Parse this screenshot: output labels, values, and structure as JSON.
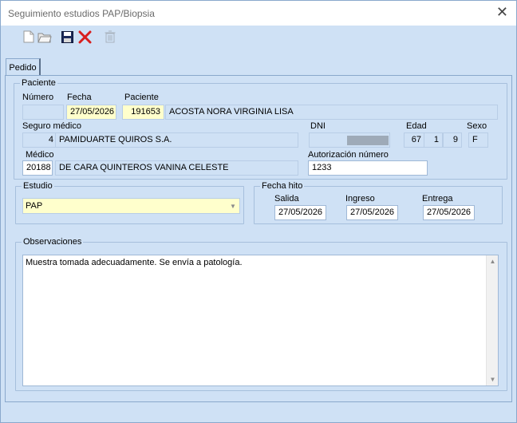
{
  "window": {
    "title": "Seguimiento estudios PAP/Biopsia"
  },
  "toolbar": {
    "new_icon": "new-document-icon",
    "open_icon": "open-folder-icon",
    "save_icon": "save-disk-icon",
    "cancel_icon": "red-x-icon",
    "delete_icon": "trash-icon"
  },
  "tabs": [
    {
      "label": "Pedido"
    }
  ],
  "paciente": {
    "group_title": "Paciente",
    "numero_label": "Número",
    "numero_value": "",
    "fecha_label": "Fecha",
    "fecha_value": "27/05/2026",
    "paciente_label": "Paciente",
    "paciente_id": "191653",
    "paciente_nombre": "ACOSTA NORA VIRGINIA LISA",
    "seguro_label": "Seguro médico",
    "seguro_code": "4",
    "seguro_name": "PAMIDUARTE QUIROS S.A.",
    "dni_label": "DNI",
    "edad_label": "Edad",
    "edad_anios": "67",
    "edad_meses": "1",
    "edad_dias": "9",
    "sexo_label": "Sexo",
    "sexo_value": "F",
    "medico_label": "Médico",
    "medico_code": "20188",
    "medico_name": "DE CARA QUINTEROS VANINA CELESTE",
    "autorizacion_label": "Autorización número",
    "autorizacion_value": "1233"
  },
  "estudio": {
    "group_title": "Estudio",
    "selected": "PAP"
  },
  "fecha_hito": {
    "group_title": "Fecha hito",
    "salida_label": "Salida",
    "salida_value": "27/05/2026",
    "ingreso_label": "Ingreso",
    "ingreso_value": "27/05/2026",
    "entrega_label": "Entrega",
    "entrega_value": "27/05/2026"
  },
  "observaciones": {
    "group_title": "Observaciones",
    "text": "Muestra tomada adecuadamente. Se envía a patología."
  },
  "colors": {
    "background": "#cfe1f5",
    "highlight_field": "#ffffcc",
    "border": "#8aa8cc",
    "cancel_red": "#d81e1e"
  }
}
